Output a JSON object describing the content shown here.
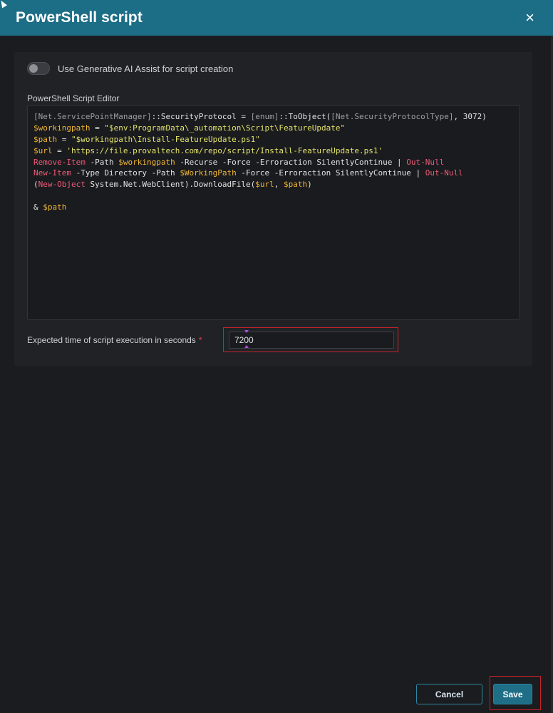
{
  "dialog": {
    "title": "PowerShell script",
    "close_icon": "×"
  },
  "ai_assist": {
    "label": "Use Generative AI Assist for script creation",
    "enabled": false
  },
  "editor": {
    "label": "PowerShell Script Editor",
    "lines": [
      [
        {
          "t": "[Net.ServicePointManager]",
          "c": "gray"
        },
        {
          "t": "::SecurityProtocol = ",
          "c": "white"
        },
        {
          "t": "[enum]",
          "c": "gray"
        },
        {
          "t": "::ToObject(",
          "c": "white"
        },
        {
          "t": "[Net.SecurityProtocolType]",
          "c": "gray"
        },
        {
          "t": ", 3072)",
          "c": "white"
        }
      ],
      [
        {
          "t": "$workingpath",
          "c": "var"
        },
        {
          "t": " = ",
          "c": "white"
        },
        {
          "t": "\"$env:ProgramData\\_automation\\Script\\FeatureUpdate\"",
          "c": "str"
        }
      ],
      [
        {
          "t": "$path",
          "c": "var"
        },
        {
          "t": " = ",
          "c": "white"
        },
        {
          "t": "\"$workingpath\\Install-FeatureUpdate.ps1\"",
          "c": "str"
        }
      ],
      [
        {
          "t": "$url",
          "c": "var"
        },
        {
          "t": " = ",
          "c": "white"
        },
        {
          "t": "'https://file.provaltech.com/repo/script/Install-FeatureUpdate.ps1'",
          "c": "str"
        }
      ],
      [
        {
          "t": "Remove-Item",
          "c": "kw"
        },
        {
          "t": " -Path ",
          "c": "white"
        },
        {
          "t": "$workingpath",
          "c": "var"
        },
        {
          "t": " -Recurse -Force -Erroraction SilentlyContinue | ",
          "c": "white"
        },
        {
          "t": "Out-Null",
          "c": "kw"
        }
      ],
      [
        {
          "t": "New-Item",
          "c": "kw"
        },
        {
          "t": " -Type ",
          "c": "white"
        },
        {
          "t": "Directory -Path ",
          "c": "white"
        },
        {
          "t": "$WorkingPath",
          "c": "var"
        },
        {
          "t": " -Force -Erroraction SilentlyContinue | ",
          "c": "white"
        },
        {
          "t": "Out-Null",
          "c": "kw"
        }
      ],
      [
        {
          "t": "(",
          "c": "white"
        },
        {
          "t": "New-Object",
          "c": "kw"
        },
        {
          "t": " System.Net.WebClient).DownloadFile(",
          "c": "white"
        },
        {
          "t": "$url",
          "c": "var"
        },
        {
          "t": ", ",
          "c": "white"
        },
        {
          "t": "$path",
          "c": "var"
        },
        {
          "t": ")",
          "c": "white"
        }
      ],
      [],
      [
        {
          "t": "& ",
          "c": "white"
        },
        {
          "t": "$path",
          "c": "var"
        }
      ]
    ]
  },
  "execution_time": {
    "label": "Expected time of script execution in seconds",
    "required_mark": "*",
    "value": "7200"
  },
  "footer": {
    "cancel_label": "Cancel",
    "save_label": "Save"
  },
  "colors": {
    "header": "#1c6d86",
    "variable": "#f2b735",
    "string": "#e3e46c",
    "keyword": "#ef5a78",
    "highlight": "#c4242b"
  }
}
